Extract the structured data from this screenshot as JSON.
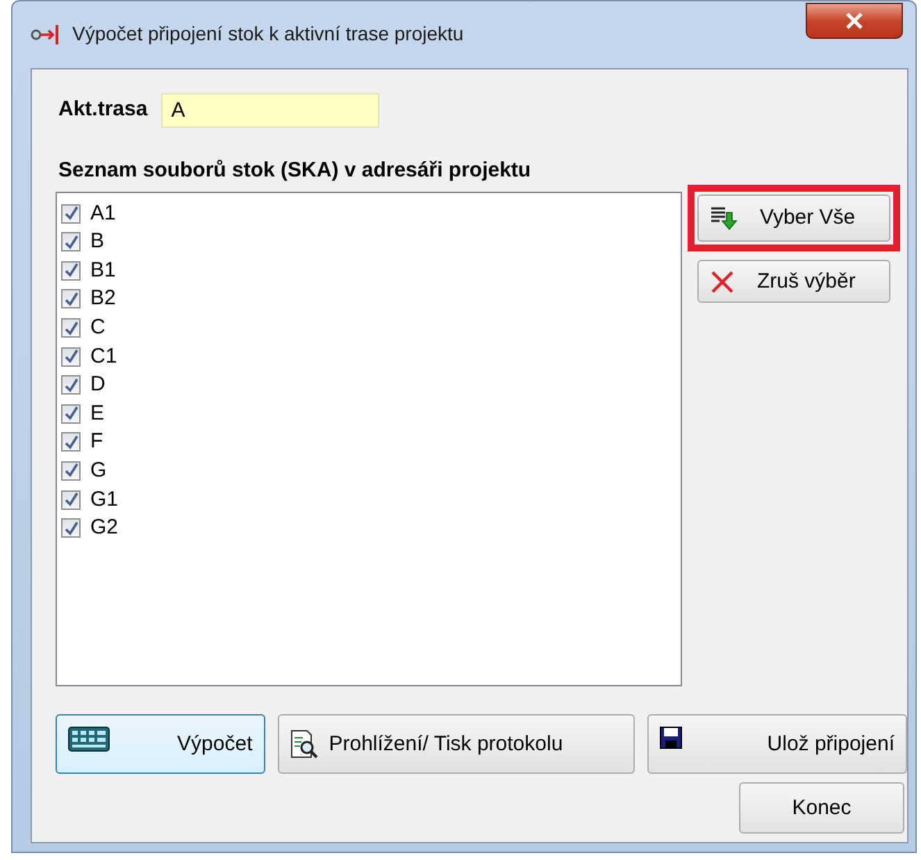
{
  "window": {
    "title": "Výpočet připojení stok k aktivní trase projektu"
  },
  "route": {
    "label": "Akt.trasa",
    "value": "A"
  },
  "list": {
    "heading": "Seznam souborů stok (SKA) v adresáři projektu",
    "items": [
      {
        "label": "A1",
        "checked": true
      },
      {
        "label": "B",
        "checked": true
      },
      {
        "label": "B1",
        "checked": true
      },
      {
        "label": "B2",
        "checked": true
      },
      {
        "label": "C",
        "checked": true
      },
      {
        "label": "C1",
        "checked": true
      },
      {
        "label": "D",
        "checked": true
      },
      {
        "label": "E",
        "checked": true
      },
      {
        "label": "F",
        "checked": true
      },
      {
        "label": "G",
        "checked": true
      },
      {
        "label": "G1",
        "checked": true
      },
      {
        "label": "G2",
        "checked": true
      }
    ]
  },
  "side_buttons": [
    {
      "label": "Vyber Vše",
      "kind": "select-all",
      "highlighted": true
    },
    {
      "label": "Zruš výběr",
      "kind": "clear",
      "highlighted": false
    }
  ],
  "bottom_buttons": [
    {
      "label": "Výpočet",
      "kind": "calculate",
      "focused": true
    },
    {
      "label": "Prohlížení/ Tisk protokolu",
      "kind": "preview",
      "focused": false
    },
    {
      "label": "Ulož připojení",
      "kind": "save",
      "focused": false
    }
  ],
  "close_button": {
    "label": "Konec"
  }
}
